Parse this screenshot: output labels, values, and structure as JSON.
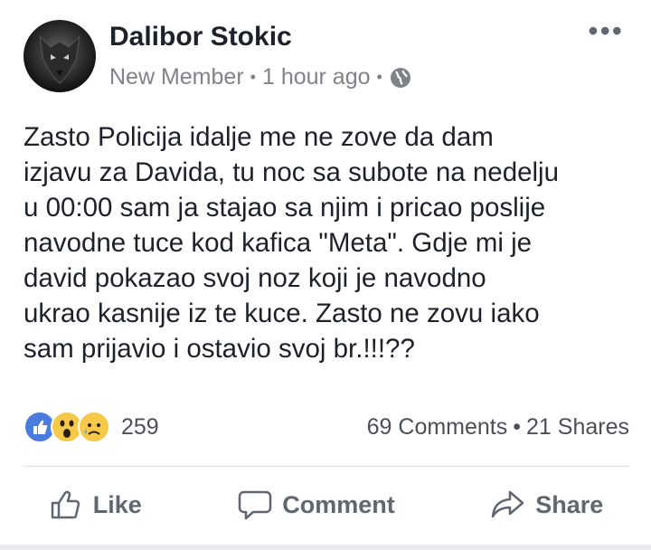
{
  "post": {
    "author_name": "Dalibor Stokic",
    "member_badge": "New Member",
    "time": "1 hour ago",
    "body": "Zasto Policija idalje me ne zove da dam\nizjavu za Davida, tu noc sa subote na nedelju\nu 00:00 sam ja stajao sa njim i pricao poslije\nnavodne tuce kod kafica \"Meta\". Gdje mi je\ndavid pokazao svoj noz koji je navodno\nukrao kasnije iz te kuce. Zasto ne zovu iako\nsam prijavio i ostavio svoj br.!!!??"
  },
  "stats": {
    "reaction_count": "259",
    "comments": "69 Comments",
    "shares": "21 Shares"
  },
  "actions": {
    "like": "Like",
    "comment": "Comment",
    "share": "Share"
  },
  "icons": [
    "avatar",
    "globe-icon",
    "more-options-icon",
    "like-reaction-icon",
    "wow-reaction-icon",
    "sad-reaction-icon",
    "thumbs-up-icon",
    "comment-icon",
    "share-icon"
  ],
  "colors": {
    "like_blue": "#4a7ce0",
    "emoji_yellow": "#f7c948",
    "text_gray": "#606770"
  }
}
